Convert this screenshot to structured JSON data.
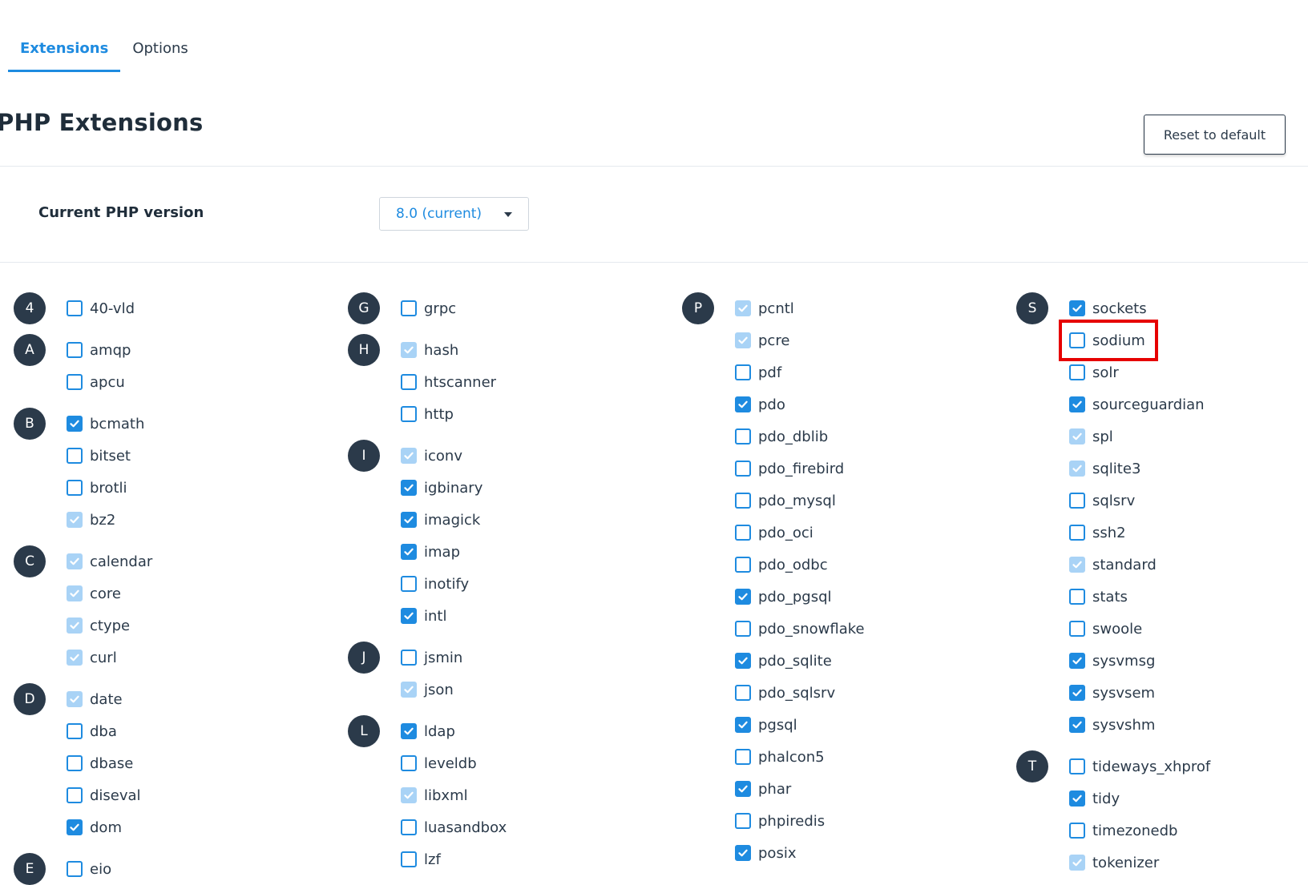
{
  "tabs": [
    {
      "label": "Extensions",
      "active": true
    },
    {
      "label": "Options",
      "active": false
    }
  ],
  "page_title": "PHP Extensions",
  "reset_button_label": "Reset to default",
  "php_version": {
    "label": "Current PHP version",
    "value": "8.0 (current)"
  },
  "colors": {
    "accent": "#1e8be0",
    "dark": "#2b3a4a",
    "locked_checkbox": "#a9d3f6",
    "highlight": "#e60000"
  },
  "icons": {
    "checkbox_check": "check-icon",
    "dropdown": "caret-down-icon"
  },
  "highlighted_extension": "sodium",
  "columns": [
    {
      "groups": [
        {
          "letter": "4",
          "items": [
            {
              "name": "40-vld",
              "state": "off"
            }
          ]
        },
        {
          "letter": "A",
          "items": [
            {
              "name": "amqp",
              "state": "off"
            },
            {
              "name": "apcu",
              "state": "off"
            }
          ]
        },
        {
          "letter": "B",
          "items": [
            {
              "name": "bcmath",
              "state": "on"
            },
            {
              "name": "bitset",
              "state": "off"
            },
            {
              "name": "brotli",
              "state": "off"
            },
            {
              "name": "bz2",
              "state": "locked"
            }
          ]
        },
        {
          "letter": "C",
          "items": [
            {
              "name": "calendar",
              "state": "locked"
            },
            {
              "name": "core",
              "state": "locked"
            },
            {
              "name": "ctype",
              "state": "locked"
            },
            {
              "name": "curl",
              "state": "locked"
            }
          ]
        },
        {
          "letter": "D",
          "items": [
            {
              "name": "date",
              "state": "locked"
            },
            {
              "name": "dba",
              "state": "off"
            },
            {
              "name": "dbase",
              "state": "off"
            },
            {
              "name": "diseval",
              "state": "off"
            },
            {
              "name": "dom",
              "state": "on"
            }
          ]
        },
        {
          "letter": "E",
          "items": [
            {
              "name": "eio",
              "state": "off"
            }
          ]
        }
      ]
    },
    {
      "groups": [
        {
          "letter": "G",
          "items": [
            {
              "name": "grpc",
              "state": "off"
            }
          ]
        },
        {
          "letter": "H",
          "items": [
            {
              "name": "hash",
              "state": "locked"
            },
            {
              "name": "htscanner",
              "state": "off"
            },
            {
              "name": "http",
              "state": "off"
            }
          ]
        },
        {
          "letter": "I",
          "items": [
            {
              "name": "iconv",
              "state": "locked"
            },
            {
              "name": "igbinary",
              "state": "on"
            },
            {
              "name": "imagick",
              "state": "on"
            },
            {
              "name": "imap",
              "state": "on"
            },
            {
              "name": "inotify",
              "state": "off"
            },
            {
              "name": "intl",
              "state": "on"
            }
          ]
        },
        {
          "letter": "J",
          "items": [
            {
              "name": "jsmin",
              "state": "off"
            },
            {
              "name": "json",
              "state": "locked"
            }
          ]
        },
        {
          "letter": "L",
          "items": [
            {
              "name": "ldap",
              "state": "on"
            },
            {
              "name": "leveldb",
              "state": "off"
            },
            {
              "name": "libxml",
              "state": "locked"
            },
            {
              "name": "luasandbox",
              "state": "off"
            },
            {
              "name": "lzf",
              "state": "off"
            }
          ]
        }
      ]
    },
    {
      "groups": [
        {
          "letter": "P",
          "items": [
            {
              "name": "pcntl",
              "state": "locked"
            },
            {
              "name": "pcre",
              "state": "locked"
            },
            {
              "name": "pdf",
              "state": "off"
            },
            {
              "name": "pdo",
              "state": "on"
            },
            {
              "name": "pdo_dblib",
              "state": "off"
            },
            {
              "name": "pdo_firebird",
              "state": "off"
            },
            {
              "name": "pdo_mysql",
              "state": "off"
            },
            {
              "name": "pdo_oci",
              "state": "off"
            },
            {
              "name": "pdo_odbc",
              "state": "off"
            },
            {
              "name": "pdo_pgsql",
              "state": "on"
            },
            {
              "name": "pdo_snowflake",
              "state": "off"
            },
            {
              "name": "pdo_sqlite",
              "state": "on"
            },
            {
              "name": "pdo_sqlsrv",
              "state": "off"
            },
            {
              "name": "pgsql",
              "state": "on"
            },
            {
              "name": "phalcon5",
              "state": "off"
            },
            {
              "name": "phar",
              "state": "on"
            },
            {
              "name": "phpiredis",
              "state": "off"
            },
            {
              "name": "posix",
              "state": "on"
            }
          ]
        }
      ]
    },
    {
      "groups": [
        {
          "letter": "S",
          "items": [
            {
              "name": "sockets",
              "state": "on"
            },
            {
              "name": "sodium",
              "state": "off"
            },
            {
              "name": "solr",
              "state": "off"
            },
            {
              "name": "sourceguardian",
              "state": "on"
            },
            {
              "name": "spl",
              "state": "locked"
            },
            {
              "name": "sqlite3",
              "state": "locked"
            },
            {
              "name": "sqlsrv",
              "state": "off"
            },
            {
              "name": "ssh2",
              "state": "off"
            },
            {
              "name": "standard",
              "state": "locked"
            },
            {
              "name": "stats",
              "state": "off"
            },
            {
              "name": "swoole",
              "state": "off"
            },
            {
              "name": "sysvmsg",
              "state": "on"
            },
            {
              "name": "sysvsem",
              "state": "on"
            },
            {
              "name": "sysvshm",
              "state": "on"
            }
          ]
        },
        {
          "letter": "T",
          "items": [
            {
              "name": "tideways_xhprof",
              "state": "off"
            },
            {
              "name": "tidy",
              "state": "on"
            },
            {
              "name": "timezonedb",
              "state": "off"
            },
            {
              "name": "tokenizer",
              "state": "locked"
            }
          ]
        }
      ]
    }
  ]
}
